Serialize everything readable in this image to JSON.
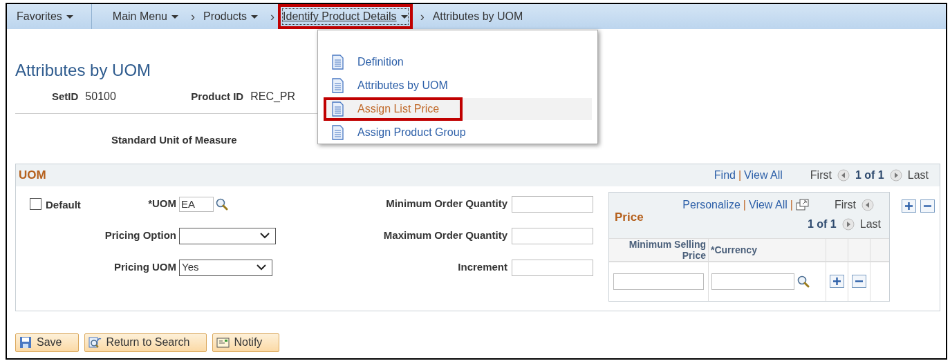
{
  "breadcrumbs": [
    {
      "label": "Favorites",
      "caret": true,
      "divider_after": true,
      "annotated": false,
      "underlined": false
    },
    {
      "label": "Main Menu",
      "caret": true,
      "divider_after": false,
      "annotated": false,
      "underlined": false
    },
    {
      "separator": "›",
      "label": "Products",
      "caret": true,
      "divider_after": false,
      "annotated": false,
      "underlined": false
    },
    {
      "separator": "›",
      "label": "Identify Product Details",
      "caret": true,
      "divider_after": false,
      "annotated": true,
      "underlined": true
    },
    {
      "separator": "›",
      "label": "Attributes by UOM",
      "caret": false,
      "divider_after": false,
      "annotated": false,
      "underlined": false
    }
  ],
  "menu": {
    "items": [
      {
        "label": "Definition",
        "selected": false,
        "annotated": false
      },
      {
        "label": "Attributes by UOM",
        "selected": false,
        "annotated": false
      },
      {
        "label": "Assign List Price",
        "selected": true,
        "annotated": true
      },
      {
        "label": "Assign Product Group",
        "selected": false,
        "annotated": false
      }
    ]
  },
  "page_title": "Attributes by UOM",
  "key_fields": [
    {
      "label": "SetID",
      "value": "50100"
    },
    {
      "label": "Product ID",
      "value": "REC_PR"
    }
  ],
  "subheading": "Standard Unit of Measure",
  "uom_section": {
    "title": "UOM",
    "links": [
      "Find",
      "View All"
    ],
    "link_separator": "|",
    "nav": {
      "first": "First",
      "count": "1 of 1",
      "last": "Last"
    },
    "default_checkbox": {
      "label": "Default",
      "checked": false
    },
    "fields": [
      {
        "kind": "lookup",
        "label": "*UOM",
        "value": "EA"
      },
      {
        "kind": "select",
        "label": "Pricing Option"
      },
      {
        "kind": "select",
        "label": "Pricing UOM",
        "value": "Yes"
      }
    ],
    "quantities": [
      {
        "label": "Minimum Order Quantity"
      },
      {
        "label": "Maximum Order Quantity"
      },
      {
        "label": "Increment"
      }
    ],
    "price_grid": {
      "title": "Price",
      "links": [
        "Personalize",
        "View All"
      ],
      "link_separators": [
        "|",
        "|"
      ],
      "nav": {
        "first": "First",
        "count": "1 of 1",
        "last": "Last"
      },
      "columns": [
        "Minimum Selling Price",
        "*Currency"
      ]
    }
  },
  "buttons": [
    {
      "kind": "save",
      "label": "Save"
    },
    {
      "kind": "search",
      "label": "Return to Search"
    },
    {
      "kind": "notify",
      "label": "Notify"
    }
  ]
}
